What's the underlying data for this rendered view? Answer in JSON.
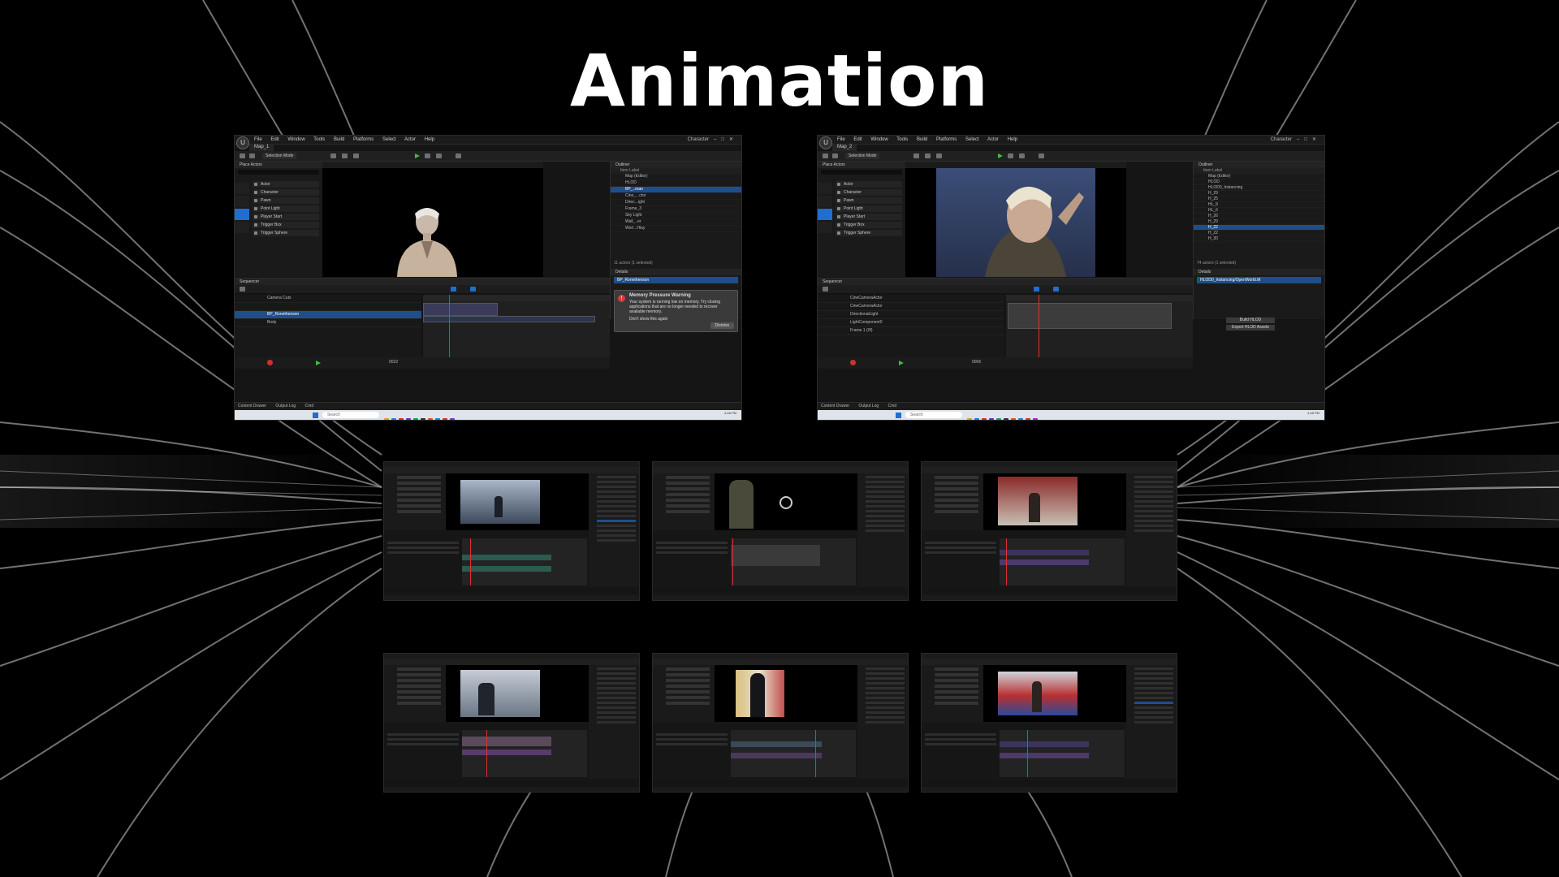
{
  "slide": {
    "title": "Animation"
  },
  "editor": {
    "menu": [
      "File",
      "Edit",
      "Window",
      "Tools",
      "Build",
      "Platforms",
      "Select",
      "Actor",
      "Help"
    ],
    "window_title": "Character",
    "selection_mode": "Selection Mode",
    "place_actors_title": "Place Actors",
    "place_items": [
      "Actor",
      "Character",
      "Pawn",
      "Point Light",
      "Player Start",
      "Trigger Box",
      "Trigger Sphere"
    ],
    "outliner_title": "Outliner",
    "outliner_columns": "Item Label",
    "details_title": "Details",
    "sequencer_title": "Sequencer",
    "status_items": [
      "Content Drawer",
      "Output Log",
      "Cmd"
    ],
    "taskbar_search": "Search",
    "clock": "4:48 PM"
  },
  "shots": {
    "left": {
      "map_tab": "Map_1",
      "outliner_rows": [
        "Item Label",
        "Map (Editor)",
        "HLOD",
        "BP_..man",
        "Cine_...ctor",
        "Direc...ight",
        "Frame_3",
        "Sky Light",
        "Wall_..er",
        "Worl...Hlay"
      ],
      "outliner_count": "11 actors (1 selected)",
      "details_object": "BP_Ronethenson",
      "warning_title": "Memory Pressure Warning",
      "warning_body": "Your system is running low on memory. Try closing applications that are no longer needed to recover available memory.",
      "warning_checkbox": "Don't show this again",
      "warning_button": "Dismiss",
      "seq_tracks": [
        "Camera Cuts",
        "",
        "BP_Ronethenson",
        "Body"
      ],
      "frame_readout": "0022"
    },
    "right": {
      "map_tab": "Map_2",
      "outliner_rows": [
        "Item Label",
        "Map (Editor)",
        "HLOD",
        "HLOD0_Instancing",
        "H_29",
        "H_25",
        "HL_9",
        "HL_6",
        "H_26",
        "H_29",
        "H_22",
        "H_22",
        "H_30"
      ],
      "outliner_count": "74 actors (1 selected)",
      "details_object": "HLOD0_Instancing/OpenWorld.M",
      "build_button": "Build HLOD",
      "export_button": "Export HLOD Assets",
      "seq_tracks": [
        "CineCameraActor",
        "CineCameraActor",
        "DirectionalLight",
        "LightComponent0",
        "Frame 1 (0f)"
      ],
      "frame_readout": "0006"
    }
  },
  "colors": {
    "accent": "#1e6fd0",
    "selection": "#1f4f8a",
    "playhead": "#e03030"
  }
}
